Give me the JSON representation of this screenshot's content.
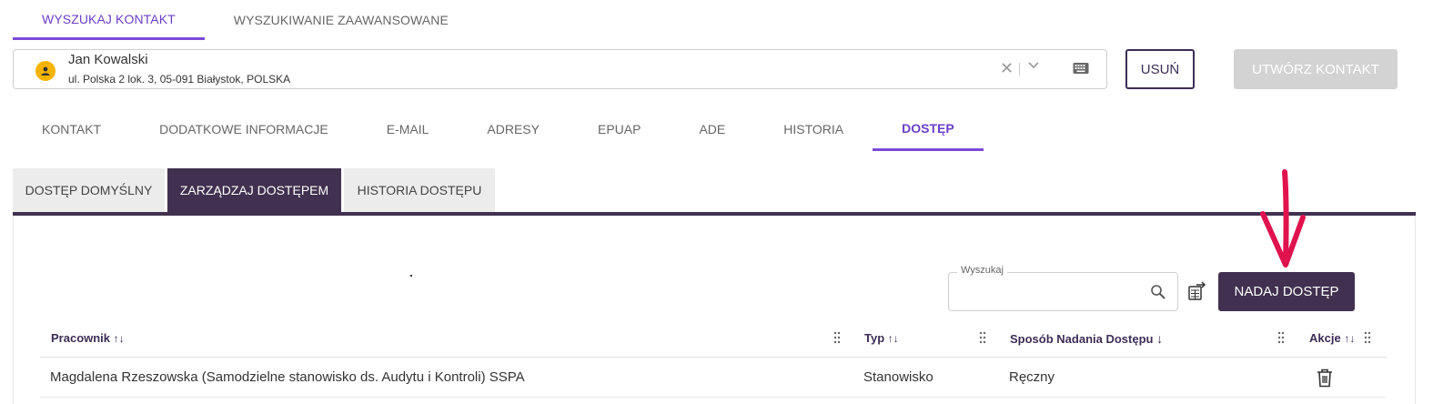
{
  "top_tabs": [
    {
      "label": "WYSZUKAJ KONTAKT",
      "active": true
    },
    {
      "label": "WYSZUKIWANIE ZAAWANSOWANE",
      "active": false
    }
  ],
  "contact": {
    "name": "Jan Kowalski",
    "address": "ul. Polska 2 lok. 3, 05-091 Białystok, POLSKA"
  },
  "buttons": {
    "delete": "USUŃ",
    "create": "UTWÓRZ KONTAKT",
    "grant": "NADAJ DOSTĘP"
  },
  "section_tabs": [
    {
      "label": "KONTAKT"
    },
    {
      "label": "DODATKOWE INFORMACJE"
    },
    {
      "label": "E-MAIL"
    },
    {
      "label": "ADRESY"
    },
    {
      "label": "EPUAP"
    },
    {
      "label": "ADE"
    },
    {
      "label": "HISTORIA"
    },
    {
      "label": "DOSTĘP",
      "active": true
    }
  ],
  "sub_tabs": [
    {
      "label": "DOSTĘP DOMYŚLNY"
    },
    {
      "label": "ZARZĄDZAJ DOSTĘPEM",
      "active": true
    },
    {
      "label": "HISTORIA DOSTĘPU"
    }
  ],
  "search": {
    "label": "Wyszukaj",
    "value": ""
  },
  "table": {
    "headers": [
      {
        "label": "Pracownik",
        "sort": "↑↓"
      },
      {
        "label": "Typ",
        "sort": "↑↓"
      },
      {
        "label": "Sposób Nadania Dostępu",
        "sort": "↓"
      },
      {
        "label": "Akcje",
        "sort": "↑↓"
      }
    ],
    "rows": [
      {
        "employee": "Magdalena Rzeszowska (Samodzielne stanowisko ds. Audytu i Kontroli) SSPA",
        "type": "Stanowisko",
        "method": "Ręczny"
      }
    ]
  },
  "colors": {
    "accent": "#7a4ad8",
    "dark": "#41304f",
    "annotation_arrow": "#e0134f"
  },
  "icons": [
    "person-icon",
    "clear-icon",
    "chevron-down-icon",
    "keyboard-icon",
    "search-icon",
    "export-icon",
    "drag-handle-icon",
    "trash-icon"
  ]
}
